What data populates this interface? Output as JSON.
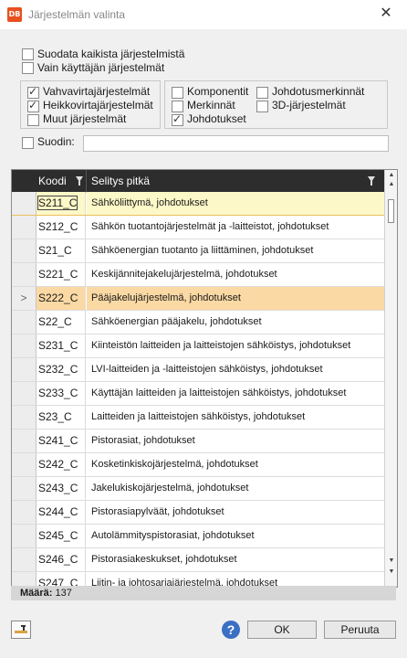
{
  "window": {
    "title": "Järjestelmän valinta",
    "app_badge": "DB",
    "close_glyph": "✕"
  },
  "options": {
    "filter_all": "Suodata kaikista järjestelmistä",
    "user_only": "Vain käyttäjän järjestelmät"
  },
  "groups_left": [
    {
      "label": "Vahvavirtajärjestelmät",
      "checked": true
    },
    {
      "label": "Heikkovirtajärjestelmät",
      "checked": true
    },
    {
      "label": "Muut järjestelmät",
      "checked": false
    }
  ],
  "groups_right": {
    "komponentit": {
      "label": "Komponentit",
      "checked": false
    },
    "merkinnat": {
      "label": "Merkinnät",
      "checked": false
    },
    "johdotukset": {
      "label": "Johdotukset",
      "checked": true
    },
    "johdotusmerkinnat": {
      "label": "Johdotusmerkinnät",
      "checked": false
    },
    "jarjestelmat3d": {
      "label": "3D-järjestelmät",
      "checked": false
    }
  },
  "filter": {
    "label": "Suodin:",
    "value": ""
  },
  "grid": {
    "col_code": "Koodi",
    "col_desc": "Selitys pitkä",
    "current_marker": ">",
    "rows": [
      {
        "code": "S211_C",
        "desc": "Sähköliittymä, johdotukset",
        "state": "sel"
      },
      {
        "code": "S212_C",
        "desc": "Sähkön tuotantojärjestelmät ja -laitteistot, johdotukset",
        "state": ""
      },
      {
        "code": "S21_C",
        "desc": "Sähköenergian tuotanto ja liittäminen, johdotukset",
        "state": ""
      },
      {
        "code": "S221_C",
        "desc": "Keskijännitejakelujärjestelmä, johdotukset",
        "state": ""
      },
      {
        "code": "S222_C",
        "desc": "Pääjakelujärjestelmä, johdotukset",
        "state": "cur"
      },
      {
        "code": "S22_C",
        "desc": "Sähköenergian pääjakelu, johdotukset",
        "state": ""
      },
      {
        "code": "S231_C",
        "desc": "Kiinteistön laitteiden ja laitteistojen sähköistys, johdotukset",
        "state": ""
      },
      {
        "code": "S232_C",
        "desc": "LVI-laitteiden ja -laitteistojen sähköistys, johdotukset",
        "state": ""
      },
      {
        "code": "S233_C",
        "desc": "Käyttäjän laitteiden ja laitteistojen sähköistys, johdotukset",
        "state": ""
      },
      {
        "code": "S23_C",
        "desc": "Laitteiden ja laitteistojen sähköistys, johdotukset",
        "state": ""
      },
      {
        "code": "S241_C",
        "desc": "Pistorasiat, johdotukset",
        "state": ""
      },
      {
        "code": "S242_C",
        "desc": "Kosketinkiskojärjestelmä, johdotukset",
        "state": ""
      },
      {
        "code": "S243_C",
        "desc": "Jakelukiskojärjestelmä, johdotukset",
        "state": ""
      },
      {
        "code": "S244_C",
        "desc": "Pistorasiapylväät, johdotukset",
        "state": ""
      },
      {
        "code": "S245_C",
        "desc": "Autolämmityspistorasiat, johdotukset",
        "state": ""
      },
      {
        "code": "S246_C",
        "desc": "Pistorasiakeskukset, johdotukset",
        "state": ""
      },
      {
        "code": "S247_C",
        "desc": "Liitin- ja johtosarjajärjestelmä, johdotukset",
        "state": ""
      }
    ]
  },
  "status": {
    "count_label": "Määrä:",
    "count_value": "137"
  },
  "footer": {
    "help_glyph": "?",
    "ok": "OK",
    "cancel": "Peruuta"
  },
  "colors": {
    "badge": "#e8501f",
    "header": "#2d2d2d",
    "selected_row": "#fdf8c8",
    "current_row": "#fbd9a4",
    "help": "#3a6fc4"
  }
}
